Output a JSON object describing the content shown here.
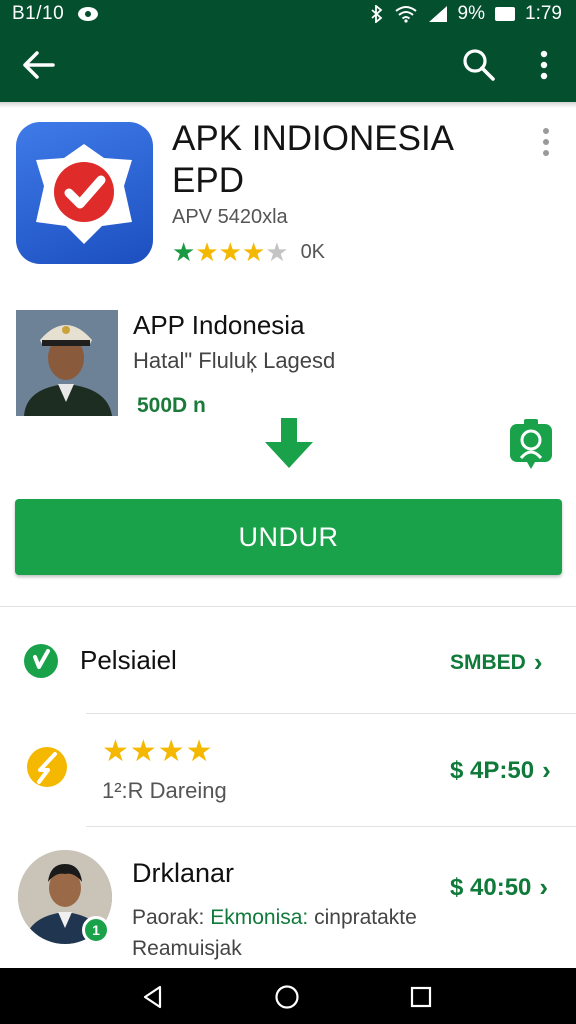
{
  "status_bar": {
    "left_text": "B1/10",
    "battery_text": "9%",
    "time": "1:79"
  },
  "icons": {
    "back": "arrow-back-icon",
    "search": "search-icon",
    "more": "more-vert-icon",
    "download": "download-arrow-icon",
    "badge": "location-badge-icon"
  },
  "app": {
    "title": "APK INDIONESIA EPD",
    "subtitle": "APV 5420xla",
    "rating_stars": 4,
    "rating_count": "0K"
  },
  "developer": {
    "name": "APP Indonesia",
    "subtitle": "Hatal\" Fluluķ Lagesd",
    "size": "500D n"
  },
  "install_button": {
    "label": "UNDUR"
  },
  "list": {
    "row1": {
      "title": "Pelsiaiel",
      "action": "SMBED"
    },
    "row2": {
      "stars": "★★★★",
      "subtitle": "1²:R Dareing",
      "price": "$ 4P:50"
    },
    "row3": {
      "name": "Drklanar",
      "price": "$ 40:50",
      "desc_prefix": "Paorak: ",
      "desc_highlight": "Ekmonisa:",
      "desc_suffix": " cinpratakte Reamuisjak",
      "badge": "1"
    }
  },
  "colors": {
    "primary_dark": "#034f2e",
    "accent_green": "#1aa24b",
    "text_green": "#0f7a3a",
    "star_gold": "#f5b800"
  }
}
